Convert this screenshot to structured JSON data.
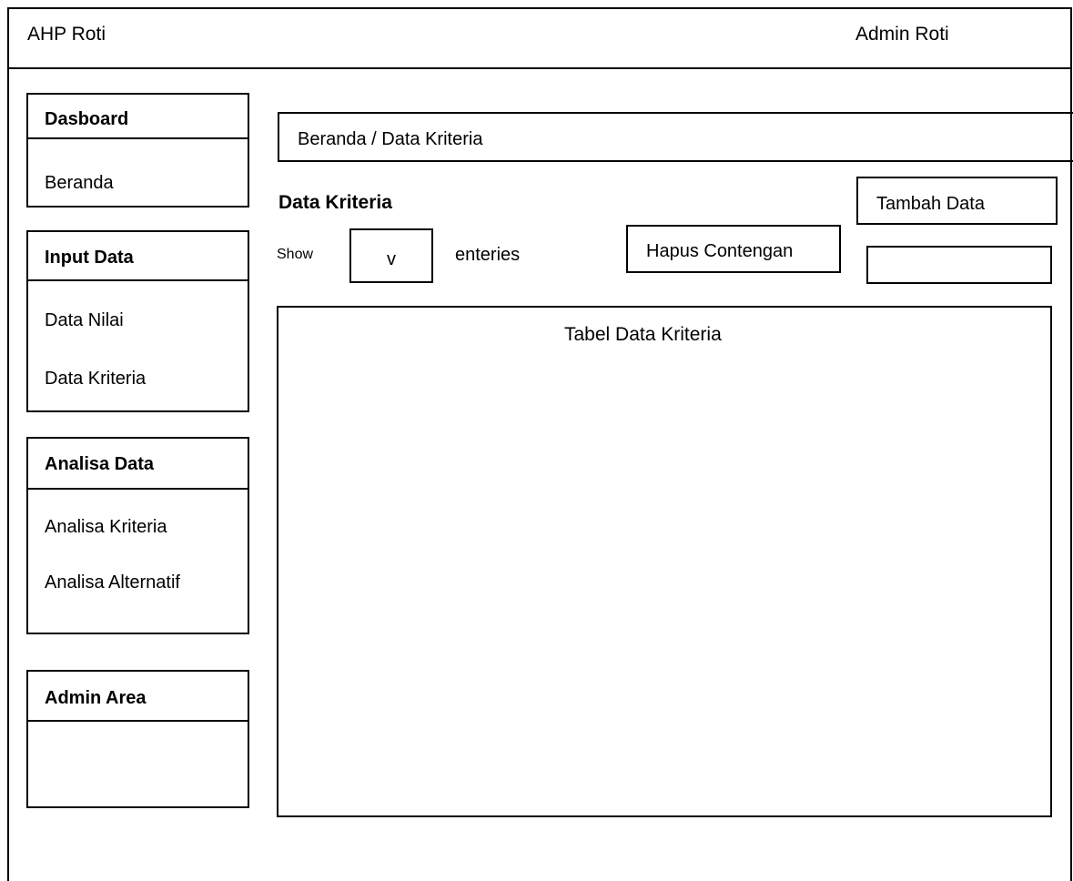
{
  "header": {
    "app_title": "AHP Roti",
    "user_name": "Admin Roti"
  },
  "sidebar": {
    "sections": [
      {
        "title": "Dasboard",
        "items": [
          "Beranda"
        ]
      },
      {
        "title": "Input Data",
        "items": [
          "Data Nilai",
          "Data Kriteria"
        ]
      },
      {
        "title": "Analisa Data",
        "items": [
          "Analisa Kriteria",
          "Analisa Alternatif"
        ]
      },
      {
        "title": "Admin Area",
        "items": []
      }
    ]
  },
  "main": {
    "breadcrumb": "Beranda / Data Kriteria",
    "page_title": "Data Kriteria",
    "add_button": "Tambah Data",
    "delete_button": "Hapus Contengan",
    "show_label": "Show",
    "entries_select_value": "v",
    "entries_label": "enteries",
    "search_value": "",
    "table_placeholder": "Tabel Data Kriteria"
  }
}
